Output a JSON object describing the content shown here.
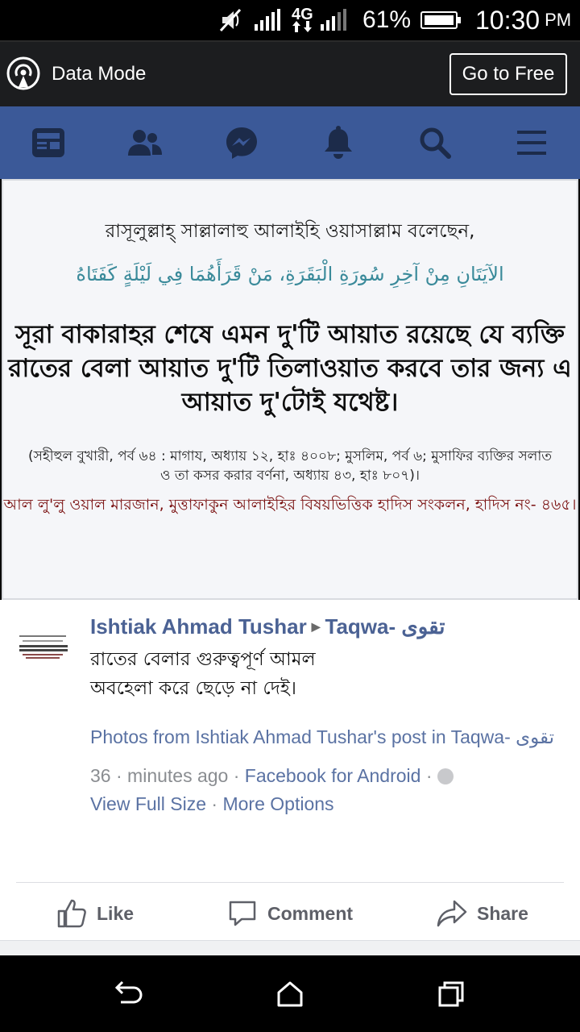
{
  "status_bar": {
    "battery_percent": "61%",
    "network": "4G",
    "time": "10:30",
    "ampm": "PM",
    "icons": [
      "mute-icon",
      "signal-icon",
      "data-arrows-icon",
      "signal-icon",
      "battery-icon"
    ]
  },
  "data_bar": {
    "label": "Data Mode",
    "go_free_label": "Go to Free",
    "icon": "broadcast-icon"
  },
  "fb_nav": {
    "icons": [
      "news-feed-icon",
      "friends-icon",
      "messenger-icon",
      "notifications-bell-icon",
      "search-icon",
      "menu-icon"
    ],
    "color": "#3b5998"
  },
  "post_image": {
    "line1": "রাসূলুল্লাহ্ সাল্লালাহু আলাইহি ওয়াসাল্লাম বলেছেন,",
    "line2_arabic": "الآيَتَانِ مِنْ آخِرِ سُورَةِ الْبَقَرَةِ، مَنْ قَرَأَهُمَا فِي لَيْلَةٍ كَفَتَاهُ",
    "main_text": "সূরা বাকারাহর শেষে এমন দু'টি আয়াত রয়েছে যে ব্যক্তি রাতের বেলা আয়াত দু'টি তিলাওয়াত করবে তার জন্য এ আয়াত দু'টোই যথেষ্ট।",
    "reference": "(সহীহুল বুখারী, পর্ব ৬৪ : মাগায, অধ্যায় ১২, হাঃ ৪০০৮; মুসলিম, পর্ব ৬; মুসাফির ব্যক্তির সলাত ও তা কসর করার বর্ণনা, অধ্যায় ৪৩, হাঃ ৮০৭)।",
    "source": "আল লু'লু ওয়াল মারজান, মুত্তাফাকুন আলাইহির বিষয়ভিত্তিক হাদিস সংকলন, হাদিস নং- ৪৬৫।"
  },
  "post": {
    "author": "Ishtiak Ahmad Tushar",
    "arrow": "▶",
    "group": "Taqwa- تقوى",
    "text_line1": "রাতের বেলার গুরুত্বপূর্ণ আমল",
    "text_line2": "অবহেলা করে ছেড়ে না দেই।",
    "photos_link": "Photos from Ishtiak Ahmad Tushar's post in Taqwa- تقوى",
    "time_meta": " · 36 minutes ago · ",
    "app": "Facebook for Android",
    "app_sep": " · ",
    "view_full_size": "View Full Size",
    "view_sep": " · ",
    "more_options": "More Options"
  },
  "actions": {
    "like": "Like",
    "comment": "Comment",
    "share": "Share"
  },
  "android_nav": {
    "icons": [
      "back-icon",
      "home-icon",
      "recents-icon"
    ]
  }
}
